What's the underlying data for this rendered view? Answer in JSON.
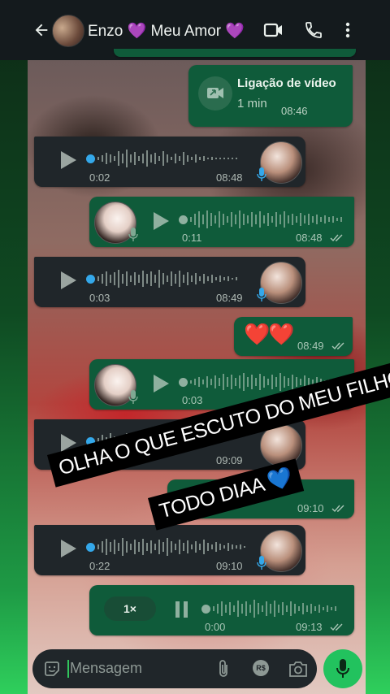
{
  "header": {
    "contact_name": "Enzo 💜 Meu Amor 💜",
    "icons": [
      "back-arrow-icon",
      "video-call-icon",
      "phone-icon",
      "more-options-icon"
    ]
  },
  "messages": [
    {
      "type": "video_call",
      "title": "Ligação de vídeo",
      "duration": "1 min",
      "time": "08:46",
      "direction": "outgoing"
    },
    {
      "type": "voice",
      "direction": "incoming",
      "duration": "0:02",
      "time": "08:48"
    },
    {
      "type": "voice",
      "direction": "outgoing",
      "duration": "0:11",
      "time": "08:48"
    },
    {
      "type": "voice",
      "direction": "incoming",
      "duration": "0:03",
      "time": "08:49"
    },
    {
      "type": "text",
      "direction": "outgoing",
      "text": "❤️❤️",
      "time": "08:49"
    },
    {
      "type": "voice",
      "direction": "outgoing",
      "duration": "0:03",
      "time": ""
    },
    {
      "type": "voice",
      "direction": "incoming",
      "duration": "",
      "time": "09:09"
    },
    {
      "type": "text",
      "direction": "outgoing",
      "text": "",
      "time": "09:10"
    },
    {
      "type": "voice",
      "direction": "incoming",
      "duration": "0:22",
      "time": "09:10"
    },
    {
      "type": "voice",
      "direction": "outgoing",
      "playing": true,
      "speed": "1×",
      "duration": "0:00",
      "time": "09:13"
    }
  ],
  "caption_overlay": {
    "line1": "OLHA O  QUE ESCUTO DO MEU FILHO",
    "line2": "TODO DIAA 💙"
  },
  "input_bar": {
    "placeholder": "Mensagem",
    "rs_label": "R$"
  },
  "colors": {
    "incoming_bubble": "#20262a",
    "outgoing_bubble": "#0f5b3a",
    "accent_green": "#22c25e",
    "dot_blue": "#34a8ea",
    "read_ticks": "#aeb8b3"
  }
}
